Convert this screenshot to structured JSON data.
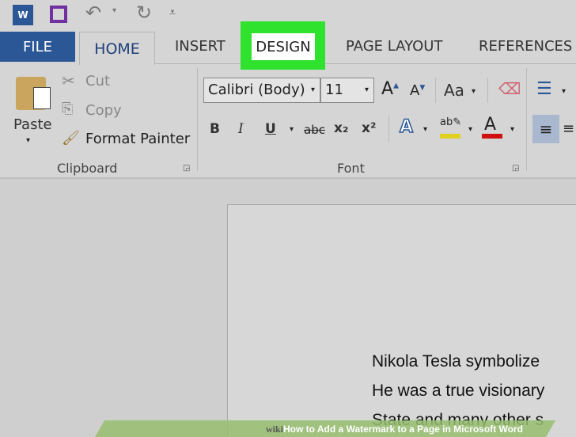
{
  "tabs": {
    "file": "FILE",
    "home": "HOME",
    "insert": "INSERT",
    "design": "DESIGN",
    "page_layout": "PAGE LAYOUT",
    "references": "REFERENCES"
  },
  "highlight_color": "#2ee22e",
  "clipboard": {
    "paste": "Paste",
    "cut": "Cut",
    "copy": "Copy",
    "format_painter": "Format Painter",
    "group": "Clipboard"
  },
  "font": {
    "name": "Calibri (Body)",
    "size": "11",
    "change_case": "Aa",
    "group": "Font",
    "bold": "B",
    "italic": "I",
    "underline": "U",
    "strike": "abc",
    "sub": "x₂",
    "sup": "x²"
  },
  "document": {
    "lines": [
      "Nikola Tesla symbolize",
      "He was a true visionary",
      "State and many other s"
    ]
  },
  "watermark": {
    "logo": "wiki",
    "title": "How to Add a Watermark to a Page in Microsoft Word"
  }
}
